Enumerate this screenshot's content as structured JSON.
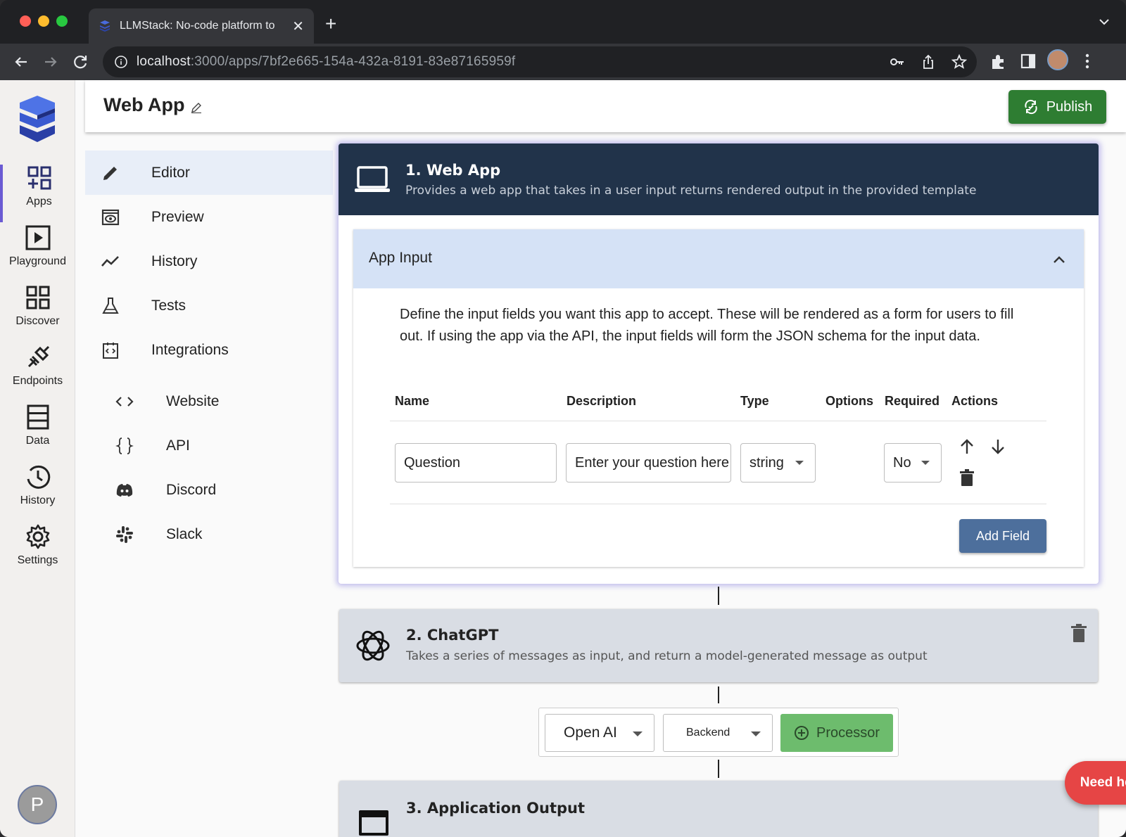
{
  "browser": {
    "tab_title": "LLMStack: No-code platform to",
    "url_host": "localhost",
    "url_path": ":3000/apps/7bf2e665-154a-432a-8191-83e87165959f"
  },
  "leftnav": {
    "items": [
      {
        "label": "Apps",
        "icon": "apps-icon"
      },
      {
        "label": "Playground",
        "icon": "play-icon"
      },
      {
        "label": "Discover",
        "icon": "grid-icon"
      },
      {
        "label": "Endpoints",
        "icon": "plug-icon"
      },
      {
        "label": "Data",
        "icon": "database-icon"
      },
      {
        "label": "History",
        "icon": "clock-icon"
      },
      {
        "label": "Settings",
        "icon": "gear-icon"
      }
    ],
    "avatar_letter": "P"
  },
  "header": {
    "title": "Web App",
    "publish_label": "Publish"
  },
  "subnav": {
    "items": [
      {
        "label": "Editor"
      },
      {
        "label": "Preview"
      },
      {
        "label": "History"
      },
      {
        "label": "Tests"
      },
      {
        "label": "Integrations"
      },
      {
        "label": "Website"
      },
      {
        "label": "API"
      },
      {
        "label": "Discord"
      },
      {
        "label": "Slack"
      }
    ]
  },
  "flow": {
    "step1": {
      "title": "1. Web App",
      "description": "Provides a web app that takes in a user input returns rendered output in the provided template"
    },
    "app_input": {
      "title": "App Input",
      "description": "Define the input fields you want this app to accept. These will be rendered as a form for users to fill out. If using the app via the API, the input fields will form the JSON schema for the input data.",
      "columns": [
        "Name",
        "Description",
        "Type",
        "Options",
        "Required",
        "Actions"
      ],
      "row": {
        "name": "Question",
        "description": "Enter your question here",
        "type": "string",
        "required": "No"
      },
      "add_field_label": "Add Field"
    },
    "step2": {
      "title": "2. ChatGPT",
      "description": "Takes a series of messages as input, and return a model-generated message as output"
    },
    "processor_bar": {
      "provider": "Open AI",
      "backend": "Backend",
      "processor_label": "Processor"
    },
    "step3": {
      "title": "3. Application Output"
    }
  },
  "help_label": "Need help?",
  "colors": {
    "primary_dark": "#21334a",
    "publish_green": "#2e7d32",
    "processor_green": "#6dbc6d",
    "help_red": "#e64545",
    "add_field_blue": "#4d6f9c"
  }
}
